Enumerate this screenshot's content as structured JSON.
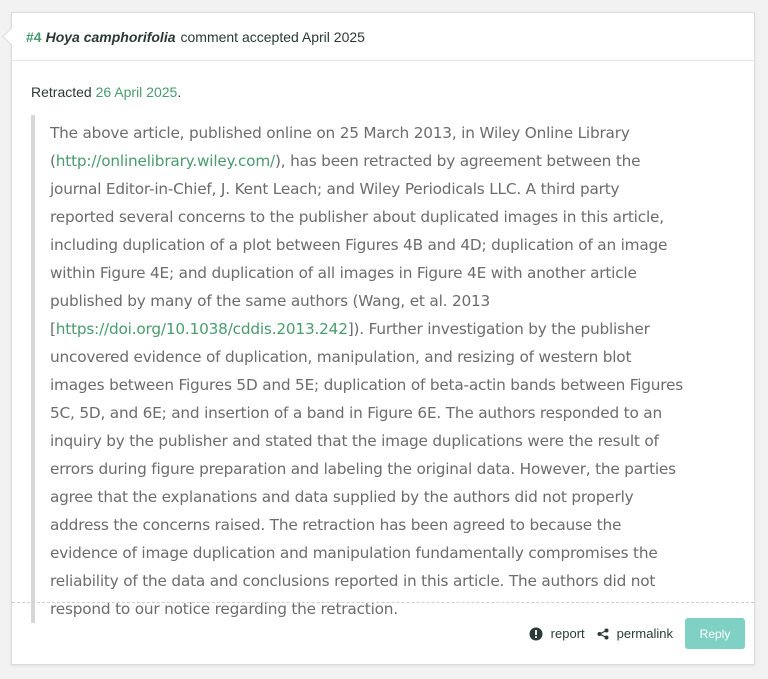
{
  "header": {
    "number": "#4",
    "species": "Hoya camphorifolia",
    "status": "comment accepted April 2025"
  },
  "retraction": {
    "prefix": "Retracted",
    "date": "26 April 2025",
    "suffix": "."
  },
  "notice": {
    "p1": "The above article, published online on 25 March 2013, in Wiley Online Library (",
    "link1": "http://onlinelibrary.wiley.com/",
    "p2": "), has been retracted by agreement between the journal Editor-in-Chief, J. Kent Leach; and Wiley Periodicals LLC. A third party reported several concerns to the publisher about duplicated images in this article, including duplication of a plot between Figures 4B and 4D; duplication of an image within Figure 4E; and duplication of all images in Figure 4E with another article published by many of the same authors (Wang, et al. 2013 [",
    "link2": "https://doi.org/10.1038/cddis.2013.242",
    "p3": "]). Further investigation by the publisher uncovered evidence of duplication, manipulation, and resizing of western blot images between Figures 5D and 5E; duplication of beta-actin bands between Figures 5C, 5D, and 6E; and insertion of a band in Figure 6E. The authors responded to an inquiry by the publisher and stated that the image duplications were the result of errors during figure preparation and labeling the original data. However, the parties agree that the explanations and data supplied by the authors did not properly address the concerns raised. The retraction has been agreed to because the evidence of image duplication and manipulation fundamentally compromises the reliability of the data and conclusions reported in this article. The authors did not respond to our notice regarding the retraction."
  },
  "footer": {
    "report_label": "report",
    "report_icon": "exclamation-circle-icon",
    "permalink_label": "permalink",
    "permalink_icon": "share-icon",
    "reply_label": "Reply"
  },
  "colors": {
    "accent": "#4a9b6e",
    "button": "#7fd1c4"
  }
}
